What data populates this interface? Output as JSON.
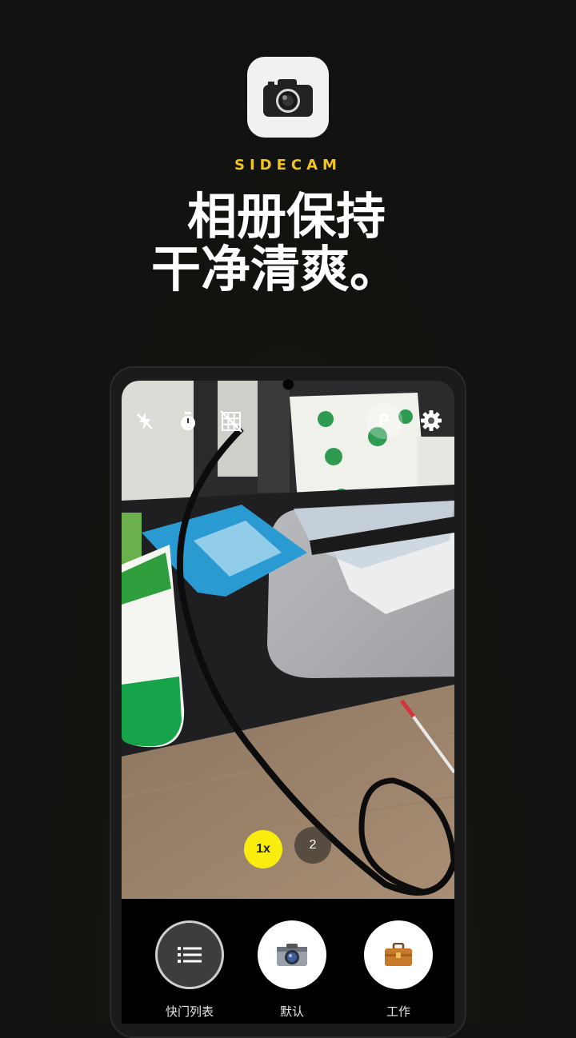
{
  "brand": {
    "name": "SIDECAM",
    "icon": "camera-icon",
    "accent_color": "#f2c418"
  },
  "headline": {
    "line1": "相册保持",
    "line2": "干净清爽。"
  },
  "camera_toolbar": {
    "icons": [
      "flash-off-icon",
      "timer-icon",
      "grid-off-icon",
      "settings-icon"
    ],
    "mode_label": "P"
  },
  "zoom": {
    "options": [
      "1x",
      "2"
    ],
    "selected": "1x",
    "selected_color": "#f9ec0f"
  },
  "presets": [
    {
      "label": "快门列表",
      "icon": "list-icon"
    },
    {
      "label": "默认",
      "icon": "camera-icon"
    },
    {
      "label": "工作",
      "icon": "briefcase-icon"
    }
  ]
}
